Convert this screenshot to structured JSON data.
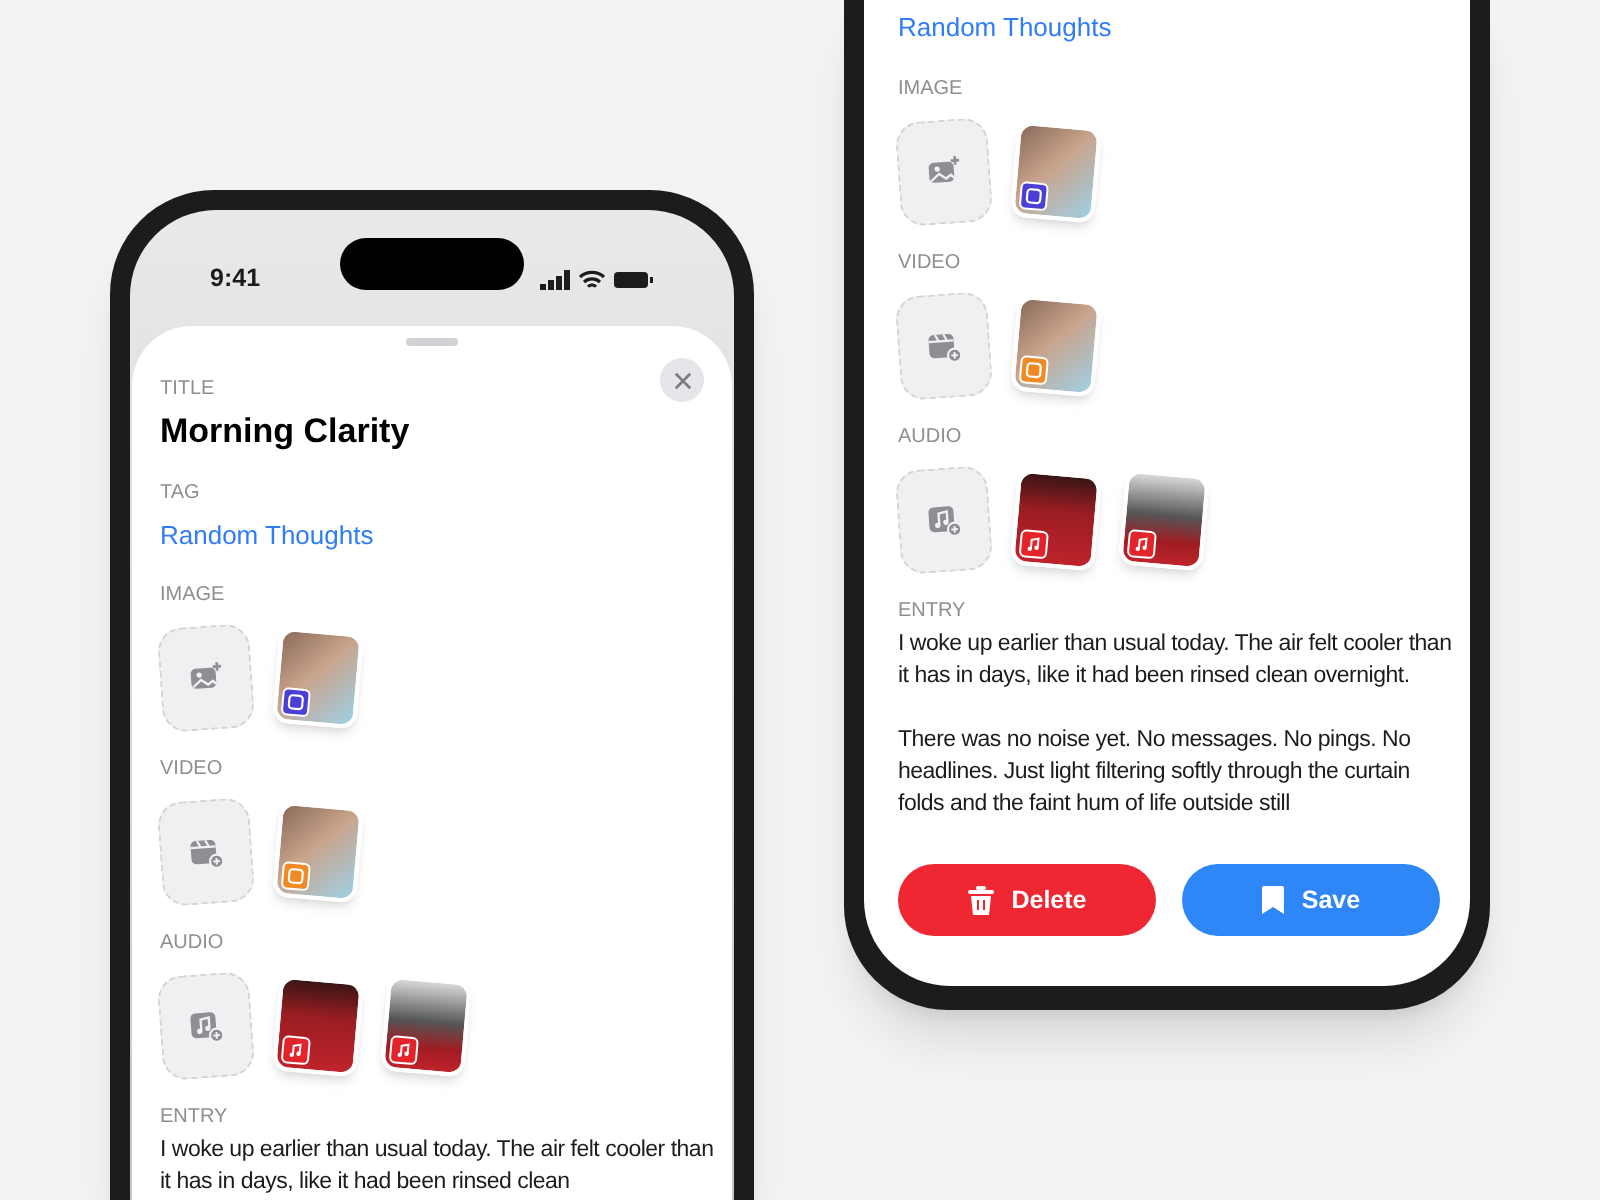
{
  "screens": [
    {
      "status_bar": {
        "time": "9:41"
      },
      "sheet": {
        "title_label": "TITLE",
        "title": "Morning Clarity",
        "tag_label": "TAG",
        "tag": "Random Thoughts",
        "media": [
          {
            "label": "IMAGE",
            "items": [
              {
                "kind": "add_image"
              },
              {
                "kind": "photo",
                "color": "#4b3fd6"
              }
            ]
          },
          {
            "label": "VIDEO",
            "items": [
              {
                "kind": "add_video"
              },
              {
                "kind": "photo",
                "color": "#f08a24"
              }
            ]
          },
          {
            "label": "AUDIO",
            "items": [
              {
                "kind": "add_audio"
              },
              {
                "kind": "album",
                "color": "#e3242b"
              },
              {
                "kind": "album_bw",
                "color": "#e3242b"
              }
            ]
          }
        ],
        "entry_label": "ENTRY",
        "entry": [
          "I woke up earlier than usual today. The air felt cooler than it has in days, like it had been rinsed clean"
        ]
      }
    },
    {
      "sheet": {
        "tag": "Random Thoughts",
        "media": [
          {
            "label": "IMAGE",
            "items": [
              {
                "kind": "add_image"
              },
              {
                "kind": "photo",
                "color": "#4b3fd6"
              }
            ]
          },
          {
            "label": "VIDEO",
            "items": [
              {
                "kind": "add_video"
              },
              {
                "kind": "photo",
                "color": "#f08a24"
              }
            ]
          },
          {
            "label": "AUDIO",
            "items": [
              {
                "kind": "add_audio"
              },
              {
                "kind": "album",
                "color": "#e3242b"
              },
              {
                "kind": "album_bw",
                "color": "#e3242b"
              }
            ]
          }
        ],
        "entry_label": "ENTRY",
        "entry": [
          "I woke up earlier than usual today. The air felt cooler than it has in days, like it had been rinsed clean overnight.",
          "There was no noise yet. No messages. No pings. No headlines. Just light filtering softly through the curtain folds and the faint hum of life outside still"
        ]
      },
      "buttons": [
        {
          "kind": "delete",
          "label": "Delete"
        },
        {
          "kind": "save",
          "label": "Save"
        }
      ]
    }
  ]
}
